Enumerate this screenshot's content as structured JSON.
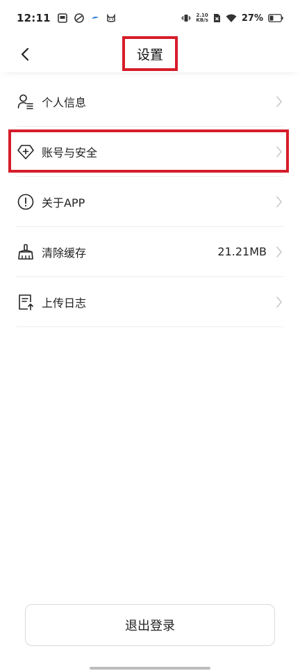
{
  "status_bar": {
    "time": "12:11",
    "speed_value": "2.10",
    "speed_unit": "KB/s",
    "battery_percent": "27%"
  },
  "header": {
    "title": "设置"
  },
  "settings": {
    "items": [
      {
        "label": "个人信息",
        "value": "",
        "icon": "person-list-icon"
      },
      {
        "label": "账号与安全",
        "value": "",
        "icon": "shield-plus-icon"
      },
      {
        "label": "关于APP",
        "value": "",
        "icon": "info-circle-icon"
      },
      {
        "label": "清除缓存",
        "value": "21.21MB",
        "icon": "broom-icon"
      },
      {
        "label": "上传日志",
        "value": "",
        "icon": "document-upload-icon"
      }
    ]
  },
  "actions": {
    "logout_label": "退出登录"
  },
  "colors": {
    "highlight": "#d61d2a",
    "divider": "#ededed",
    "chevron": "#c8c8c8"
  }
}
